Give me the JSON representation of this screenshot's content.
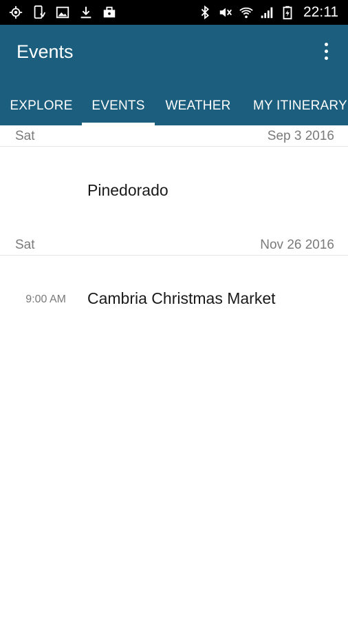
{
  "status_bar": {
    "time": "22:11",
    "left_icons": [
      "location-icon",
      "phone-sync-icon",
      "image-icon",
      "download-icon",
      "briefcase-icon"
    ],
    "right_icons": [
      "bluetooth-icon",
      "mute-icon",
      "wifi-icon",
      "signal-icon",
      "battery-icon"
    ]
  },
  "app_bar": {
    "title": "Events",
    "menu_icon": "overflow-menu-icon",
    "background": "#1b5e7e"
  },
  "tabs": [
    {
      "label": "EXPLORE",
      "active": false
    },
    {
      "label": "EVENTS",
      "active": true
    },
    {
      "label": "WEATHER",
      "active": false
    },
    {
      "label": "MY ITINERARY",
      "active": false
    }
  ],
  "days": [
    {
      "dow": "Sat",
      "date": "Sep 3 2016",
      "events": [
        {
          "time": "",
          "name": "Pinedorado"
        }
      ]
    },
    {
      "dow": "Sat",
      "date": "Nov 26 2016",
      "events": [
        {
          "time": "9:00 AM",
          "name": "Cambria Christmas Market"
        }
      ]
    }
  ]
}
